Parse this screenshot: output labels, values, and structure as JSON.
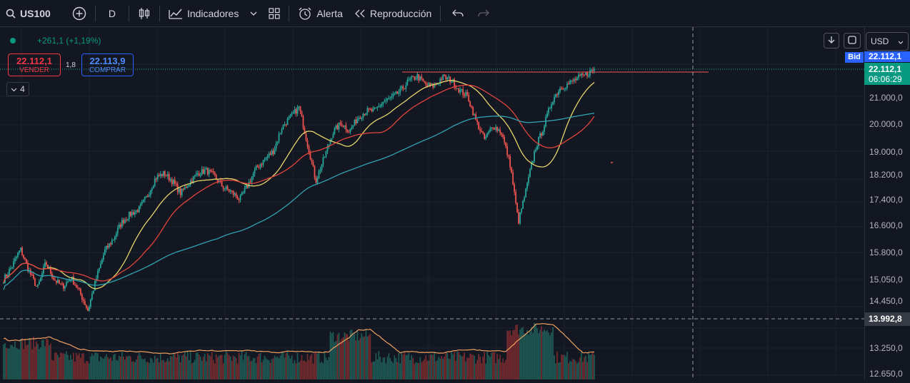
{
  "toolbar": {
    "symbol": "US100",
    "interval": "D",
    "indicators_label": "Indicadores",
    "alert_label": "Alerta",
    "replay_label": "Reproducción"
  },
  "legend": {
    "change": "+261,1 (+1,19%)",
    "sell_price": "22.112,1",
    "sell_label": "VENDER",
    "spread": "1,8",
    "buy_price": "22.113,9",
    "buy_label": "COMPRAR",
    "indicators_count": "4"
  },
  "price_axis": {
    "currency": "USD",
    "bid_tag": "Bid",
    "bid_price": "22.112,1",
    "last_price": "22.112,1",
    "countdown": "06:06:29",
    "crosshair_price": "13.992,8",
    "labels": [
      "21.000,0",
      "20.000,0",
      "19.000,0",
      "18.200,0",
      "17.400,0",
      "16.600,0",
      "15.800,0",
      "15.050,0",
      "14.450,0",
      "13.250,0",
      "12.650,0"
    ]
  },
  "colors": {
    "background": "#131722",
    "up": "#26a69a",
    "down": "#ef5350",
    "ma_fast": "#e6d56a",
    "ma_mid": "#e0443c",
    "ma_slow": "#2fa2b0",
    "volume_ma": "#f0a060",
    "resistance": "#f05a5a",
    "last_price": "#22ab94",
    "bid": "#2962ff"
  },
  "chart_data": {
    "type": "candlestick",
    "symbol": "US100",
    "interval": "D",
    "ylim": [
      12650,
      22700
    ],
    "y_ticks": [
      21000,
      20000,
      19000,
      18200,
      17400,
      16600,
      15800,
      15050,
      14450,
      13250,
      12650
    ],
    "close_anchors": [
      15050,
      15420,
      15900,
      15300,
      14800,
      15520,
      15050,
      14850,
      15100,
      14700,
      14200,
      15100,
      15850,
      16200,
      16700,
      16950,
      17100,
      17500,
      18100,
      18250,
      18000,
      17600,
      17950,
      18250,
      18350,
      18150,
      17800,
      17650,
      17400,
      17900,
      18450,
      18750,
      19050,
      19900,
      20250,
      20650,
      19300,
      18000,
      18800,
      19700,
      20050,
      19750,
      20250,
      20500,
      20500,
      20850,
      21000,
      21250,
      21650,
      21850,
      21500,
      21450,
      21800,
      21700,
      21300,
      21050,
      20100,
      19450,
      19950,
      19700,
      18600,
      16700,
      17800,
      19100,
      19900,
      20900,
      21400,
      21550,
      21750,
      21900,
      22112
    ],
    "resistance": 22000,
    "crosshair": 13992.8,
    "last": 22112.1
  }
}
